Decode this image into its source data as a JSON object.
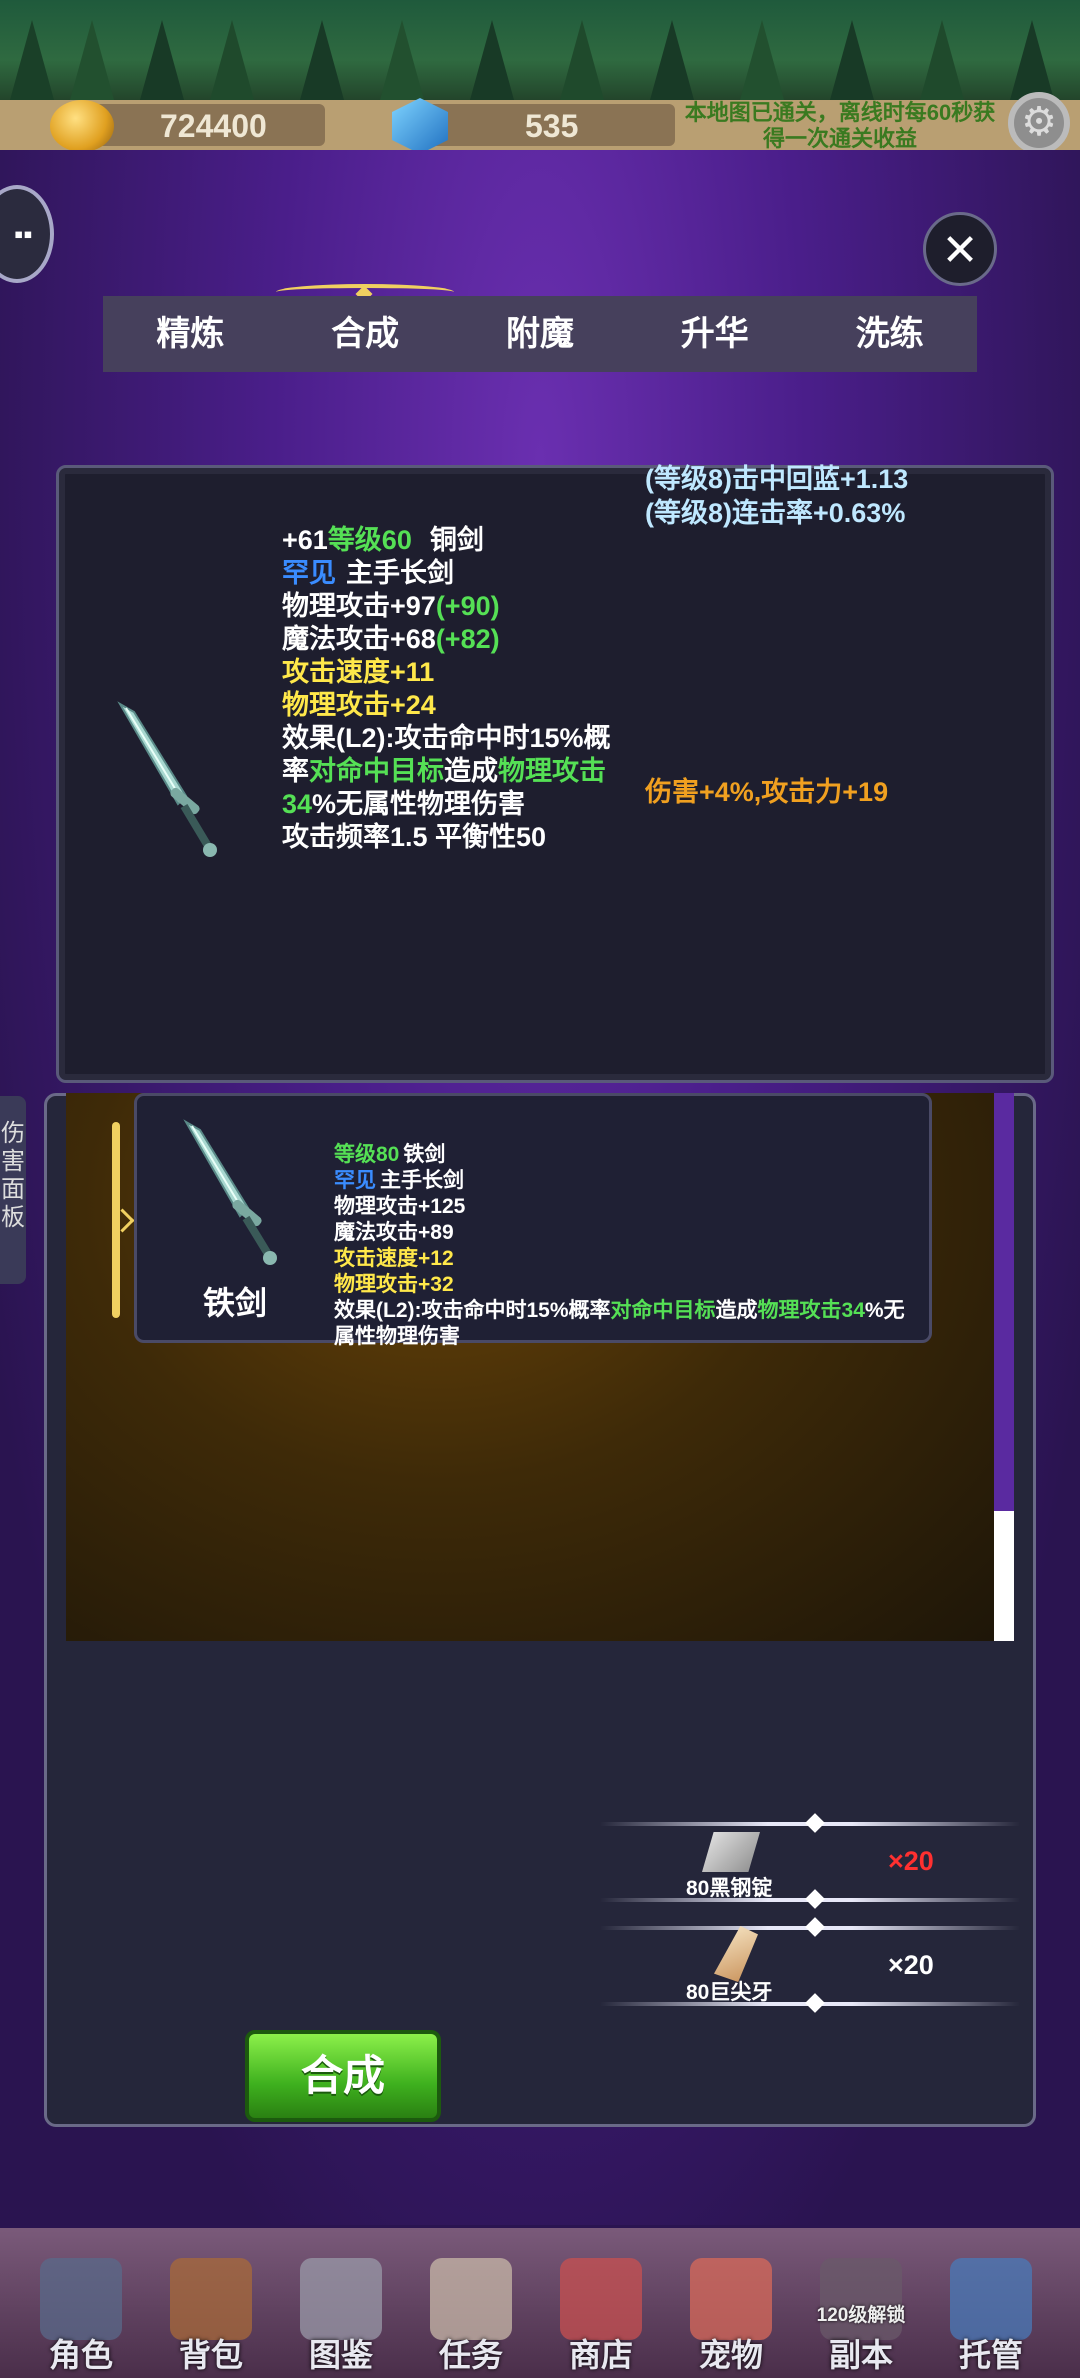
{
  "resources": {
    "gold": "724400",
    "gems": "535",
    "notice": "本地图已通关，离线时每60秒获得一次通关收益"
  },
  "tabs": [
    "精炼",
    "合成",
    "附魔",
    "升华",
    "洗练"
  ],
  "active_tab": "合成",
  "close_glyph": "✕",
  "current_item": {
    "refine": "+61",
    "level": "等级60",
    "name": "铜剑",
    "rarity": "罕见",
    "type": "主手长剑",
    "phys_atk": "物理攻击+97",
    "phys_atk_bonus": "(+90)",
    "magic_atk": "魔法攻击+68",
    "magic_atk_bonus": "(+82)",
    "atk_speed": "攻击速度+11",
    "phys_atk_extra": "物理攻击+24",
    "effect_a": "效果(L2):攻击命中时15%概",
    "effect_b1": "率",
    "effect_b2": "对命中目标",
    "effect_b3": "造成",
    "effect_b4": "物理攻击",
    "effect_c1": "34",
    "effect_c2": "%无属性物理伤害",
    "freq": "攻击频率1.5 平衡性50",
    "set_bonus_1": "(等级8)击中回蓝+1.13",
    "set_bonus_2": "(等级8)连击率+0.63%",
    "extra_bonus": "伤害+4%,攻击力+19"
  },
  "side_tab": "伤害面板",
  "target_item": {
    "name": "铁剑",
    "level": "等级80",
    "title": "铁剑",
    "rarity": "罕见",
    "type": "主手长剑",
    "phys_atk": "物理攻击+125",
    "magic_atk": "魔法攻击+89",
    "atk_speed": "攻击速度+12",
    "phys_atk_extra": "物理攻击+32",
    "effect_1": "效果(L2):攻击命中时15%概率",
    "effect_2": "对命中目标",
    "effect_3": "造成",
    "effect_4": "物理攻击34",
    "effect_5": "%无",
    "effect_6": "属性物理伤害"
  },
  "materials": [
    {
      "name": "80黑钢锭",
      "count": "×20",
      "count_color": "#ff3030"
    },
    {
      "name": "80巨尖牙",
      "count": "×20",
      "count_color": "#ffffff"
    }
  ],
  "craft_button": "合成",
  "nav": {
    "items": [
      "角色",
      "背包",
      "图鉴",
      "任务",
      "商店",
      "宠物",
      "副本",
      "托管"
    ],
    "unlock_note": "120级解锁"
  }
}
